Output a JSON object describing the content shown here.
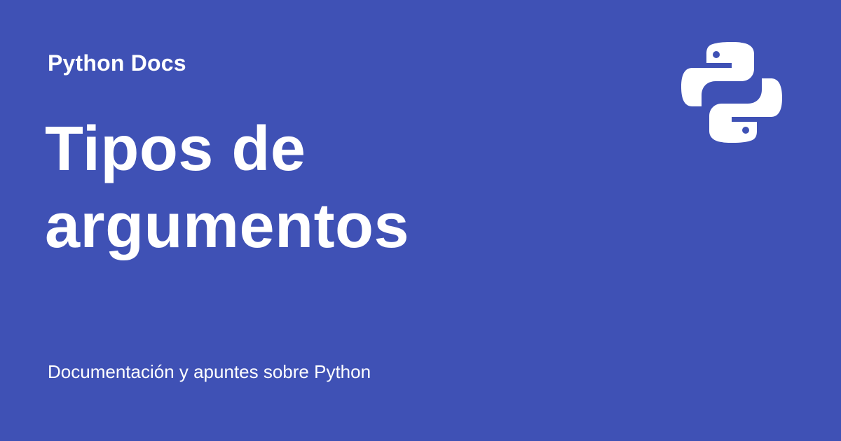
{
  "header": {
    "site_name": "Python Docs",
    "logo_icon": "python-logo-icon"
  },
  "main": {
    "title": "Tipos de argumentos",
    "description": "Documentación y apuntes sobre Python"
  },
  "colors": {
    "background": "#3f51b5",
    "text": "#ffffff"
  }
}
